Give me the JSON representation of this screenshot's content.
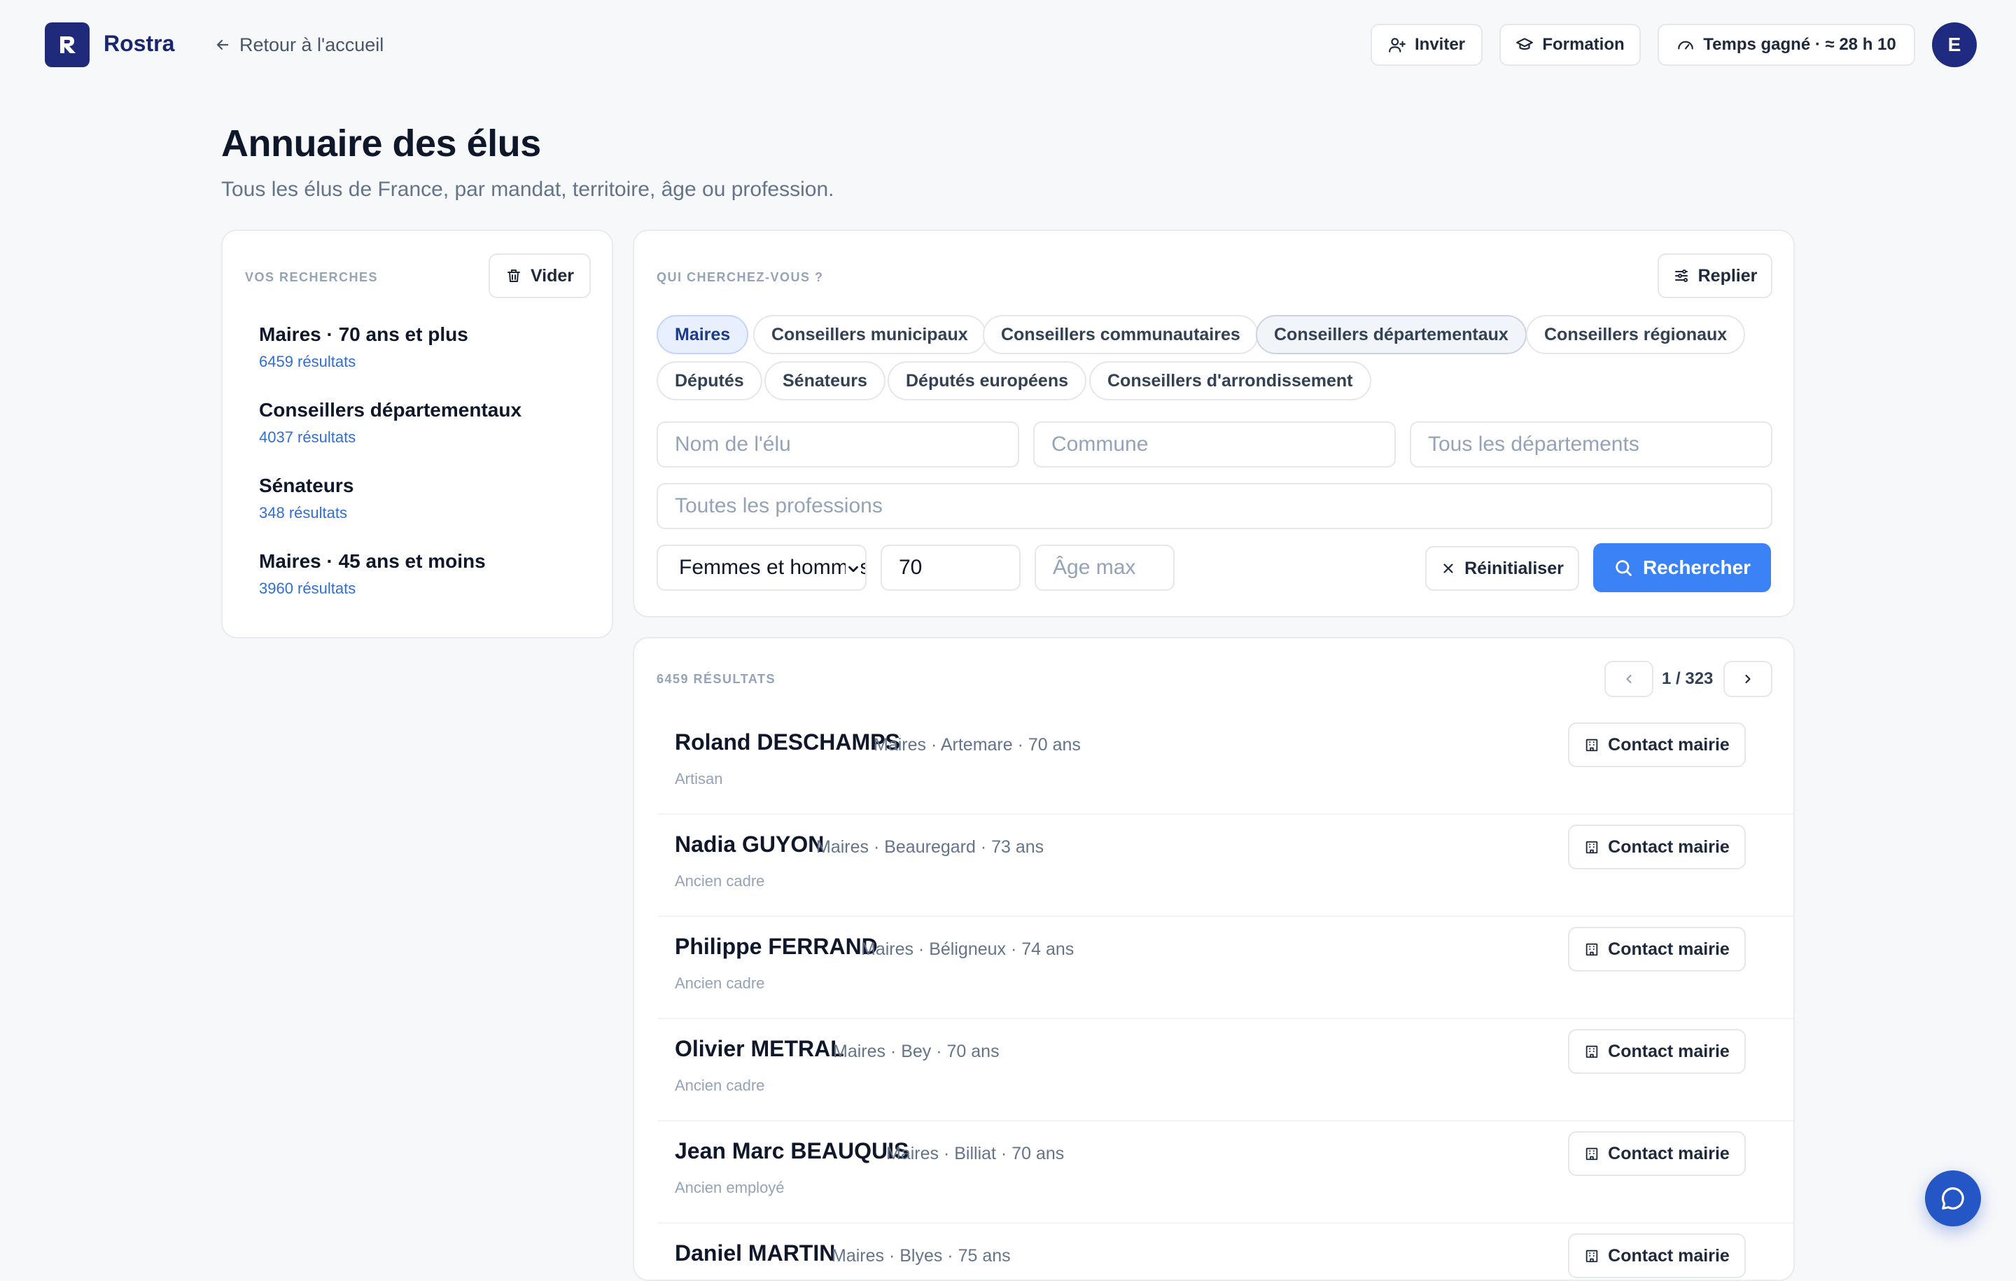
{
  "brand": {
    "name": "Rostra"
  },
  "nav": {
    "back_label": "Retour à l'accueil"
  },
  "header": {
    "invite_label": "Inviter",
    "training_label": "Formation",
    "time_saved_label": "Temps gagné · ≈ 28 h 10",
    "avatar_initial": "E"
  },
  "page": {
    "title": "Annuaire des élus",
    "subtitle": "Tous les élus de France, par mandat, territoire, âge ou profession."
  },
  "saved_searches": {
    "section_label": "VOS RECHERCHES",
    "clear_label": "Vider",
    "items": [
      {
        "title": "Maires · 70 ans et plus",
        "count": "6459 résultats"
      },
      {
        "title": "Conseillers départementaux",
        "count": "4037 résultats"
      },
      {
        "title": "Sénateurs",
        "count": "348 résultats"
      },
      {
        "title": "Maires · 45 ans et moins",
        "count": "3960 résultats"
      }
    ]
  },
  "search": {
    "section_label": "QUI CHERCHEZ-VOUS ?",
    "collapse_label": "Replier",
    "mandates": [
      {
        "label": "Maires",
        "state": "selected"
      },
      {
        "label": "Conseillers municipaux",
        "state": "default"
      },
      {
        "label": "Conseillers communautaires",
        "state": "default"
      },
      {
        "label": "Conseillers départementaux",
        "state": "hover"
      },
      {
        "label": "Conseillers régionaux",
        "state": "default"
      },
      {
        "label": "Députés",
        "state": "default"
      },
      {
        "label": "Sénateurs",
        "state": "default"
      },
      {
        "label": "Députés européens",
        "state": "default"
      },
      {
        "label": "Conseillers d'arrondissement",
        "state": "default"
      }
    ],
    "name_placeholder": "Nom de l'élu",
    "commune_placeholder": "Commune",
    "department_placeholder": "Tous les départements",
    "profession_placeholder": "Toutes les professions",
    "gender_value": "Femmes et hommes",
    "age_min_value": "70",
    "age_max_placeholder": "Âge max",
    "reset_label": "Réinitialiser",
    "submit_label": "Rechercher"
  },
  "results": {
    "count_label": "6459 RÉSULTATS",
    "page_label": "1 / 323",
    "contact_label": "Contact mairie",
    "items": [
      {
        "name": "Roland DESCHAMPS",
        "meta": "Maires · Artemare · 70 ans",
        "profession": "Artisan"
      },
      {
        "name": "Nadia GUYON",
        "meta": "Maires · Beauregard · 73 ans",
        "profession": "Ancien cadre"
      },
      {
        "name": "Philippe FERRAND",
        "meta": "Maires · Béligneux · 74 ans",
        "profession": "Ancien cadre"
      },
      {
        "name": "Olivier METRAL",
        "meta": "Maires · Bey · 70 ans",
        "profession": "Ancien cadre"
      },
      {
        "name": "Jean Marc BEAUQUIS",
        "meta": "Maires · Billiat · 70 ans",
        "profession": "Ancien employé"
      },
      {
        "name": "Daniel MARTIN",
        "meta": "Maires · Blyes · 75 ans",
        "profession": ""
      }
    ]
  },
  "colors": {
    "brand": "#1f2a7a",
    "accent": "#3b82f6",
    "link": "#2f6fd6",
    "chip_active_bg": "#e8efff",
    "background": "#f7f8fa"
  }
}
